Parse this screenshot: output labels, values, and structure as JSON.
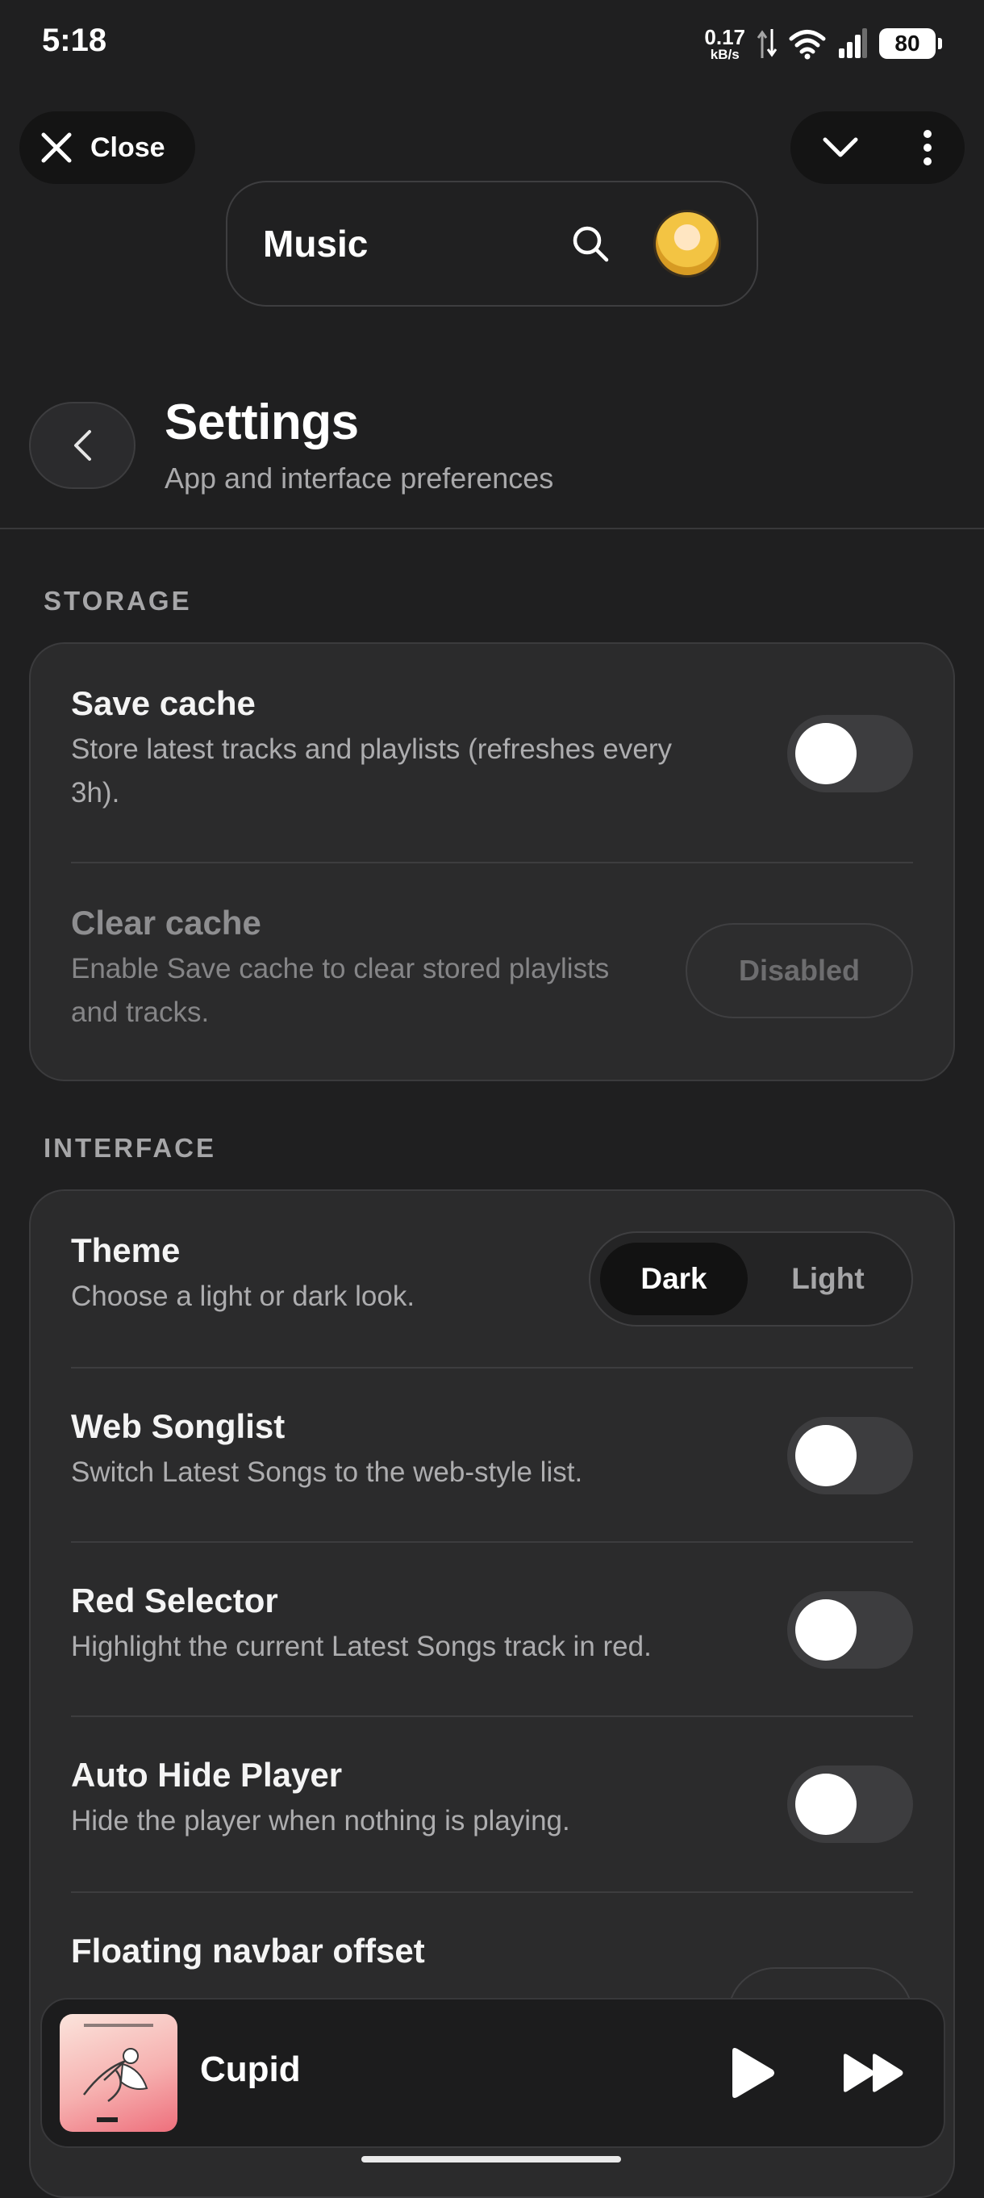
{
  "status_bar": {
    "time": "5:18",
    "net_speed": "0.17",
    "net_unit": "kB/s",
    "battery": "80"
  },
  "top_bar": {
    "close_label": "Close",
    "search_title": "Music"
  },
  "header": {
    "title": "Settings",
    "subtitle": "App and interface preferences"
  },
  "storage": {
    "section_label": "STORAGE",
    "save_cache": {
      "title": "Save cache",
      "desc_line1": "Store latest tracks and playlists (refreshes every",
      "desc_line2": "3h).",
      "enabled": false
    },
    "clear_cache": {
      "title": "Clear cache",
      "desc_line1": "Enable Save cache to clear stored playlists",
      "desc_line2": "and tracks.",
      "button_label": "Disabled"
    }
  },
  "interface": {
    "section_label": "INTERFACE",
    "theme": {
      "title": "Theme",
      "desc": "Choose a light or dark look.",
      "options": [
        "Dark",
        "Light"
      ],
      "selected": "Dark"
    },
    "web_songlist": {
      "title": "Web Songlist",
      "desc": "Switch Latest Songs to the web-style list.",
      "enabled": false
    },
    "red_selector": {
      "title": "Red Selector",
      "desc": "Highlight the current Latest Songs track in red.",
      "enabled": false
    },
    "auto_hide_player": {
      "title": "Auto Hide Player",
      "desc": "Hide the player when nothing is playing.",
      "enabled": false
    },
    "floating_navbar_offset": {
      "title": "Floating navbar offset"
    }
  },
  "player": {
    "track_title": "Cupid"
  },
  "colors": {
    "background": "#1f1f20",
    "card": "#2b2b2c",
    "toggle_off": "#3d3d3f"
  }
}
